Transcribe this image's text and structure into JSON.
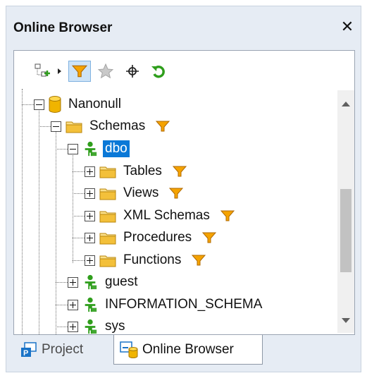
{
  "window": {
    "title": "Online Browser",
    "close_glyph": "✕"
  },
  "toolbar": {
    "buttons": [
      {
        "name": "add-datasource-icon",
        "active": false
      },
      {
        "name": "dropdown-arrow-icon",
        "active": false
      },
      {
        "name": "filter-icon",
        "active": true
      },
      {
        "name": "favorites-star-icon",
        "active": false
      },
      {
        "name": "crosshair-locate-icon",
        "active": false
      },
      {
        "name": "refresh-icon",
        "active": false
      }
    ]
  },
  "tree": {
    "database": {
      "label": "Nanonull"
    },
    "schemas_folder": {
      "label": "Schemas"
    },
    "schema_dbo": {
      "label": "dbo"
    },
    "dbo_children": [
      {
        "label": "Tables"
      },
      {
        "label": "Views"
      },
      {
        "label": "XML Schemas"
      },
      {
        "label": "Procedures"
      },
      {
        "label": "Functions"
      }
    ],
    "other_schemas": [
      {
        "label": "guest"
      },
      {
        "label": "INFORMATION_SCHEMA"
      },
      {
        "label": "sys"
      }
    ]
  },
  "tabs": [
    {
      "label": "Project",
      "active": false
    },
    {
      "label": "Online Browser",
      "active": true
    }
  ],
  "colors": {
    "selection": "#0a78d7",
    "folder": "#f3c03a",
    "filter": "#e59400",
    "schema_user": "#2f9e1c",
    "database": "#f0b400"
  }
}
